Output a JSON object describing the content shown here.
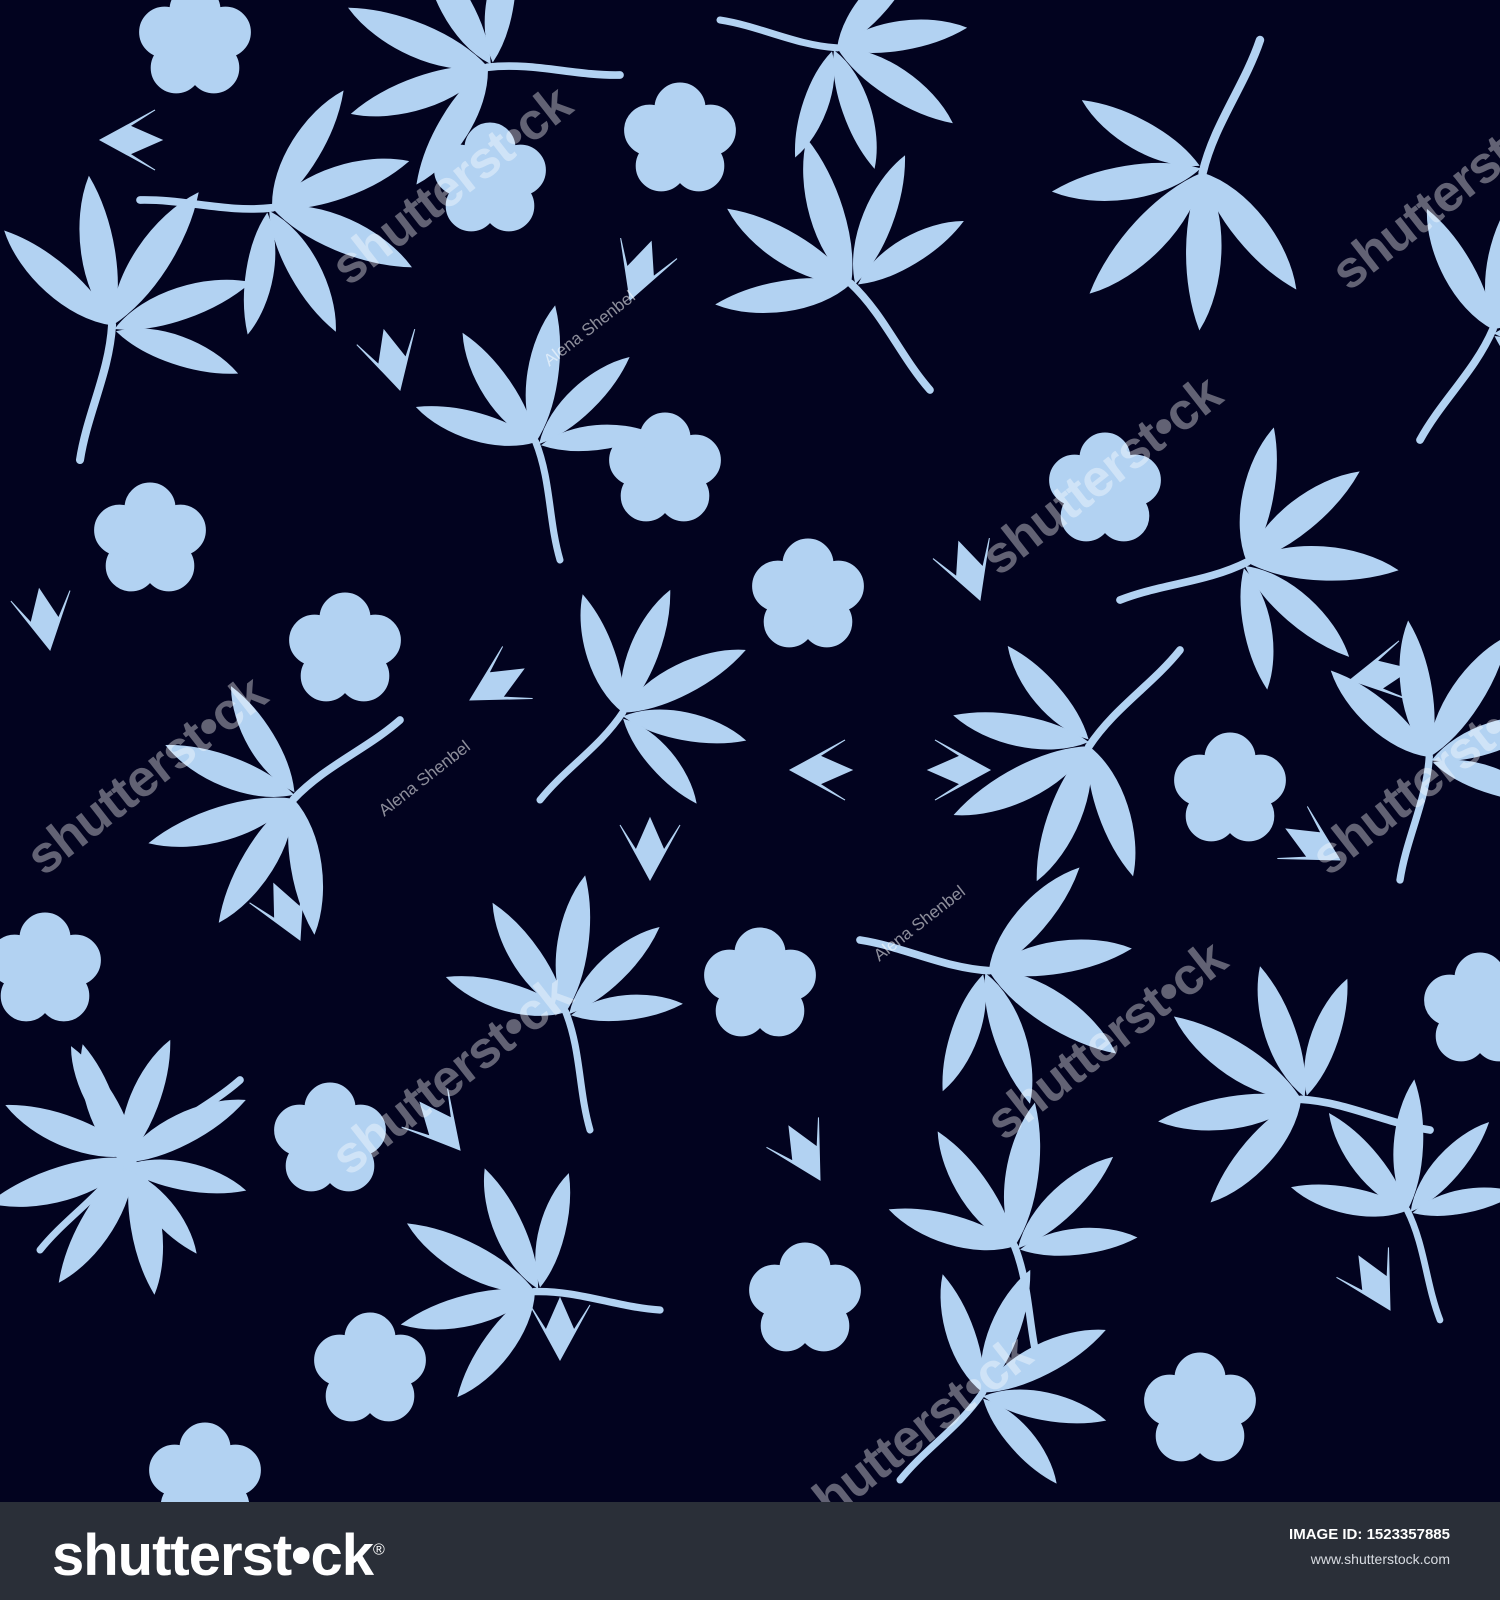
{
  "colors": {
    "background": "#02031f",
    "motif": "#b2d2f2",
    "footer_bg": "#2a2f38"
  },
  "watermarks": {
    "brand": "shutterst•ck",
    "author": "Alena Shenbel"
  },
  "footer": {
    "logo": "shutterst•ck",
    "image_id_label": "IMAGE ID:",
    "image_id": "1523357885",
    "site": "www.shutterstock.com"
  },
  "icons": [
    "leaf-sprig-icon",
    "flower-icon",
    "tulip-bud-icon"
  ]
}
